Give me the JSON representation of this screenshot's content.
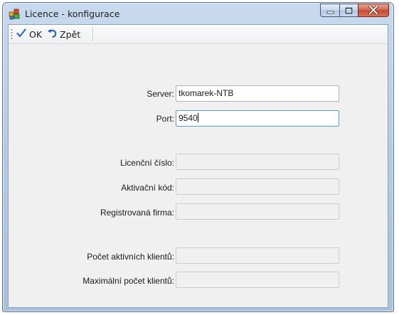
{
  "window": {
    "title": "Licence - konfigurace",
    "icon": "license-config-icon"
  },
  "caption_buttons": {
    "minimize": "minimize-icon",
    "maximize": "maximize-icon",
    "close": "close-icon"
  },
  "toolbar": {
    "ok_label": "OK",
    "back_label": "Zpět"
  },
  "form": {
    "server": {
      "label": "Server:",
      "value": "tkomarek-NTB"
    },
    "port": {
      "label": "Port:",
      "value": "9540"
    },
    "license_number": {
      "label": "Licenční číslo:",
      "value": ""
    },
    "activation_code": {
      "label": "Aktivační kód:",
      "value": ""
    },
    "registered_company": {
      "label": "Registrovaná firma:",
      "value": ""
    },
    "active_clients": {
      "label": "Počet aktivních klientů:",
      "value": ""
    },
    "max_clients": {
      "label": "Maximální počet klientů:",
      "value": ""
    }
  },
  "colors": {
    "ok_check": "#2f6fb8",
    "back_arrow": "#2a64b0",
    "close_button": "#c44a31"
  }
}
